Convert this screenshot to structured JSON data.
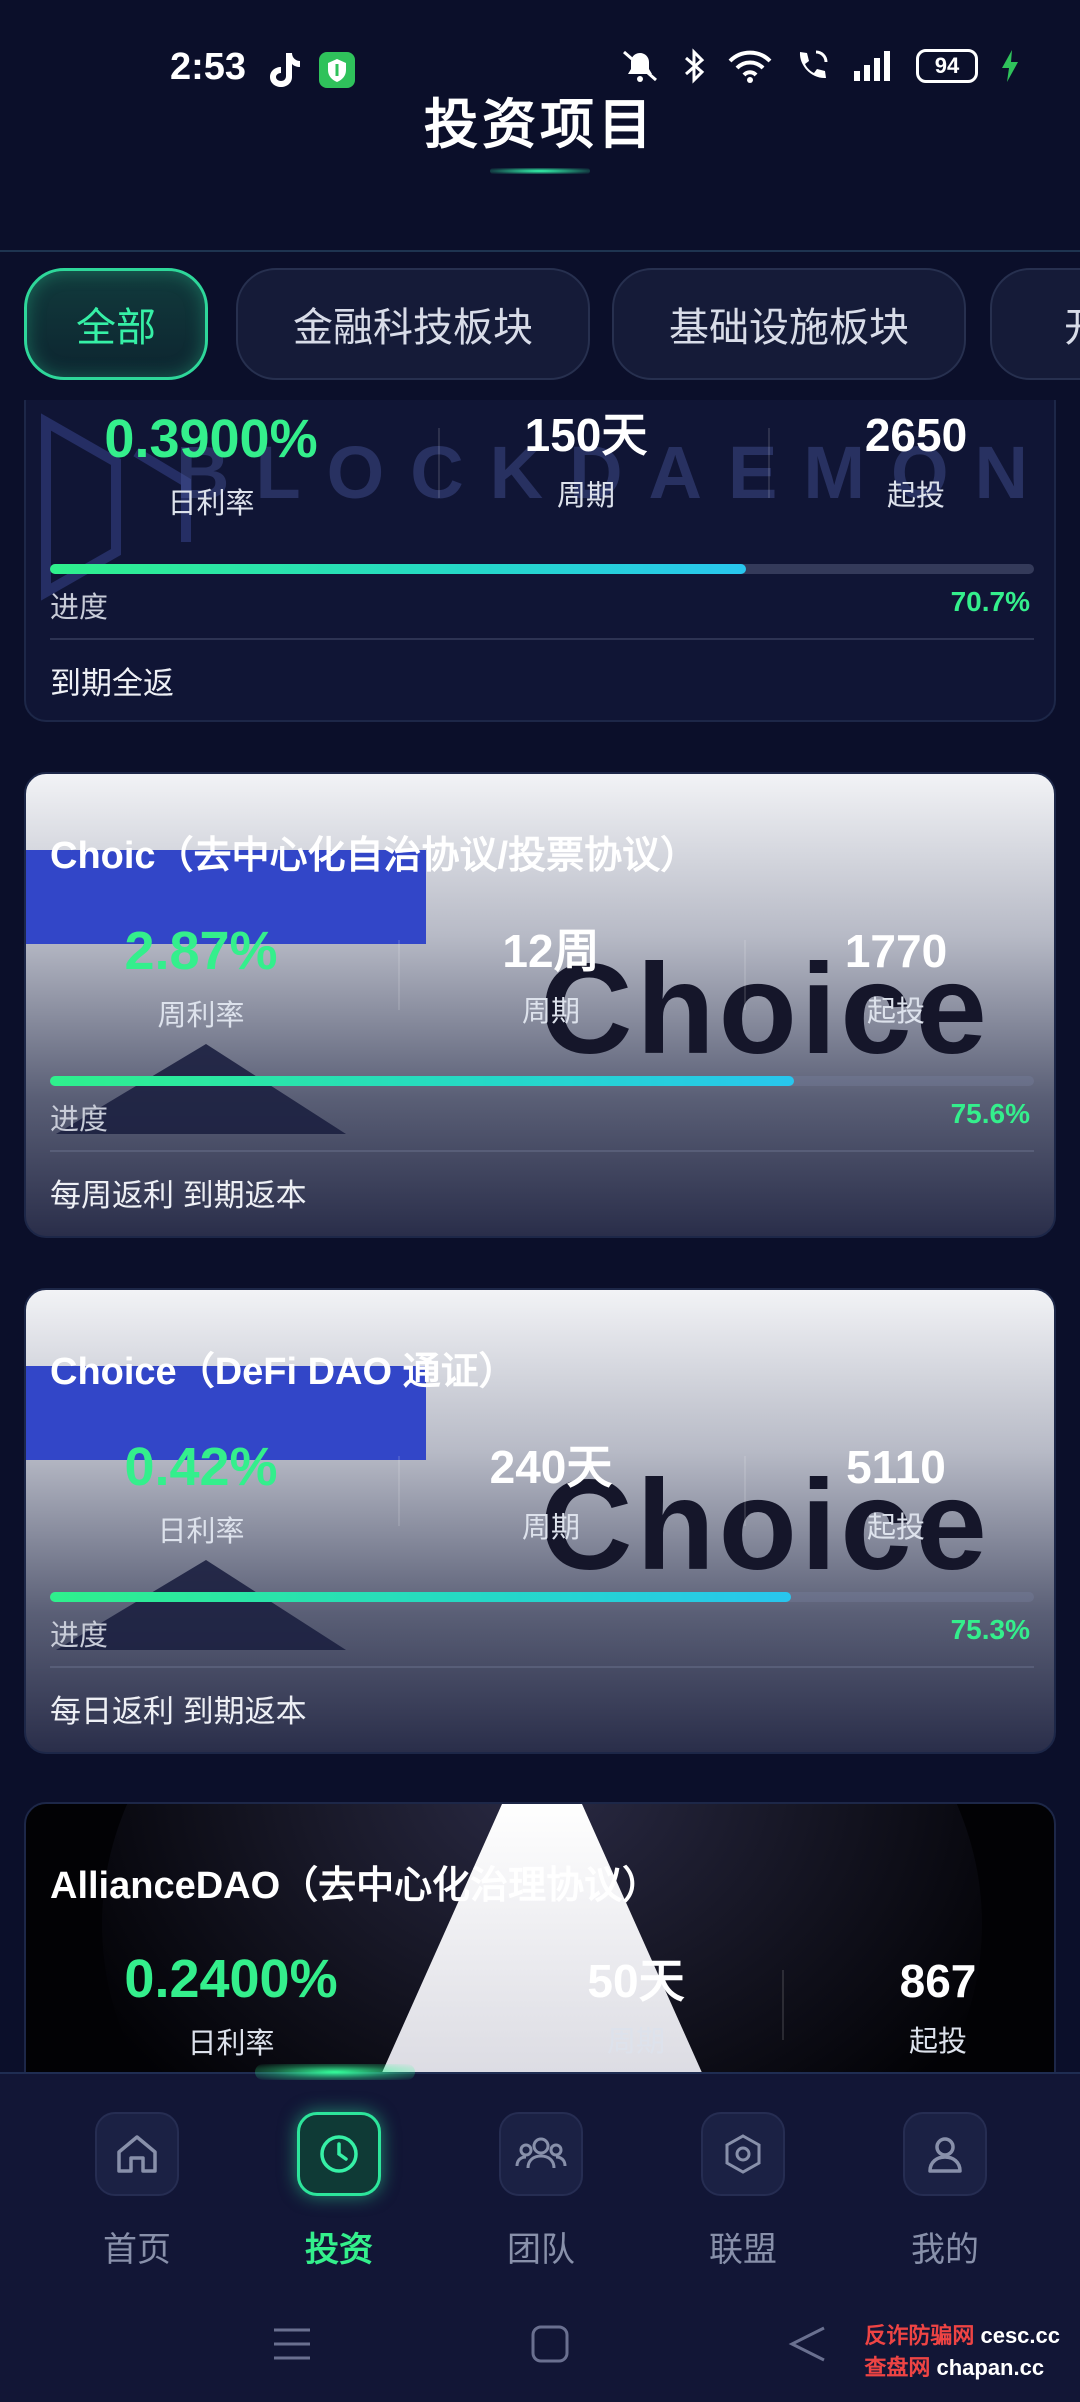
{
  "status_bar": {
    "time": "2:53",
    "battery": "94"
  },
  "header": {
    "title": "投资项目"
  },
  "tabs": [
    {
      "label": "全部",
      "active": true
    },
    {
      "label": "金融科技板块",
      "active": false
    },
    {
      "label": "基础设施板块",
      "active": false
    },
    {
      "label": "开",
      "active": false
    }
  ],
  "cards": [
    {
      "title": "",
      "watermark": "BLOCKDAEMON",
      "rate": "0.3900%",
      "rate_label": "日利率",
      "period": "150天",
      "period_label": "周期",
      "min": "2650",
      "min_label": "起投",
      "progress_label": "进度",
      "progress": 0.707,
      "progress_text": "70.7%",
      "footer": "到期全返"
    },
    {
      "title": "Choic（去中心化自治协议/投票协议）",
      "watermark": "Choice",
      "rate": "2.87%",
      "rate_label": "周利率",
      "period": "12周",
      "period_label": "周期",
      "min": "1770",
      "min_label": "起投",
      "progress_label": "进度",
      "progress": 0.756,
      "progress_text": "75.6%",
      "footer": "每周返利 到期返本"
    },
    {
      "title": "Choice（DeFi DAO 通证）",
      "watermark": "Choice",
      "rate": "0.42%",
      "rate_label": "日利率",
      "period": "240天",
      "period_label": "周期",
      "min": "5110",
      "min_label": "起投",
      "progress_label": "进度",
      "progress": 0.753,
      "progress_text": "75.3%",
      "footer": "每日返利 到期返本"
    },
    {
      "title": "AllianceDAO（去中心化治理协议）",
      "rate": "0.2400%",
      "rate_label": "日利率",
      "period": "50天",
      "period_label": "周期",
      "min": "867",
      "min_label": "起投"
    }
  ],
  "nav": [
    {
      "label": "首页",
      "icon": "home-icon",
      "active": false
    },
    {
      "label": "投资",
      "icon": "clock-icon",
      "active": true
    },
    {
      "label": "团队",
      "icon": "team-icon",
      "active": false
    },
    {
      "label": "联盟",
      "icon": "alliance-icon",
      "active": false
    },
    {
      "label": "我的",
      "icon": "user-icon",
      "active": false
    }
  ],
  "corner_watermark": {
    "line1": "反诈防骗网",
    "line1b": "cesc.cc",
    "line2": "查盘网",
    "line2b": "chapan.cc"
  },
  "colors": {
    "accent_green": "#34ef8c",
    "background": "#0b0f2a",
    "nav_bg": "#121636"
  }
}
